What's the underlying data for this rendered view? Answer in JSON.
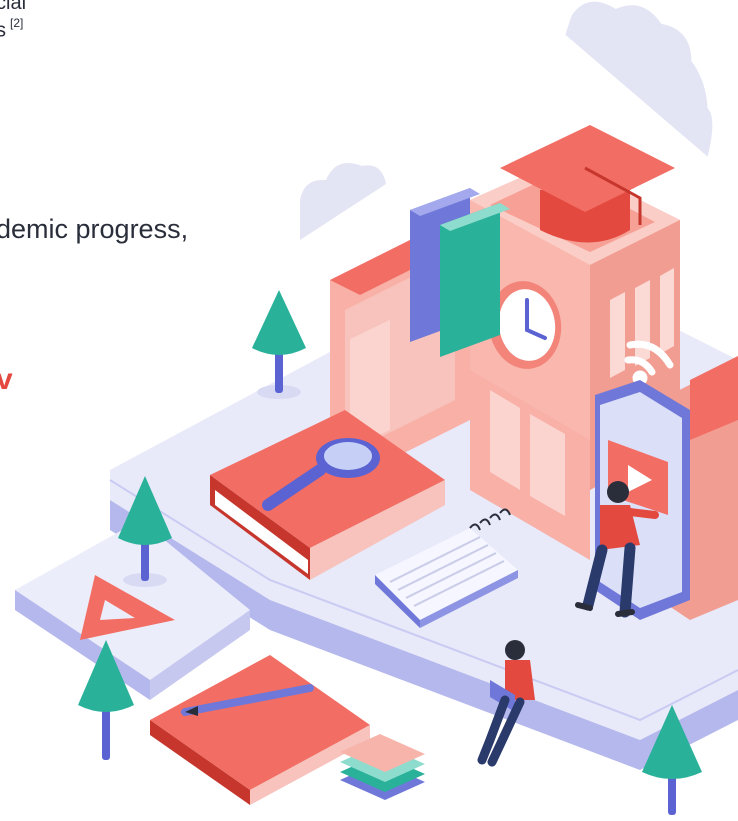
{
  "text": {
    "line1": "cial",
    "line2": "s",
    "line2_ref": "[2]",
    "line3": "demic progress,",
    "line4": "v"
  },
  "colors": {
    "accent": "#e3493f",
    "text": "#2a2e3b",
    "platform": "#e8e9f9",
    "tree": "#2ab19a",
    "cloud": "#e2e4f3"
  }
}
